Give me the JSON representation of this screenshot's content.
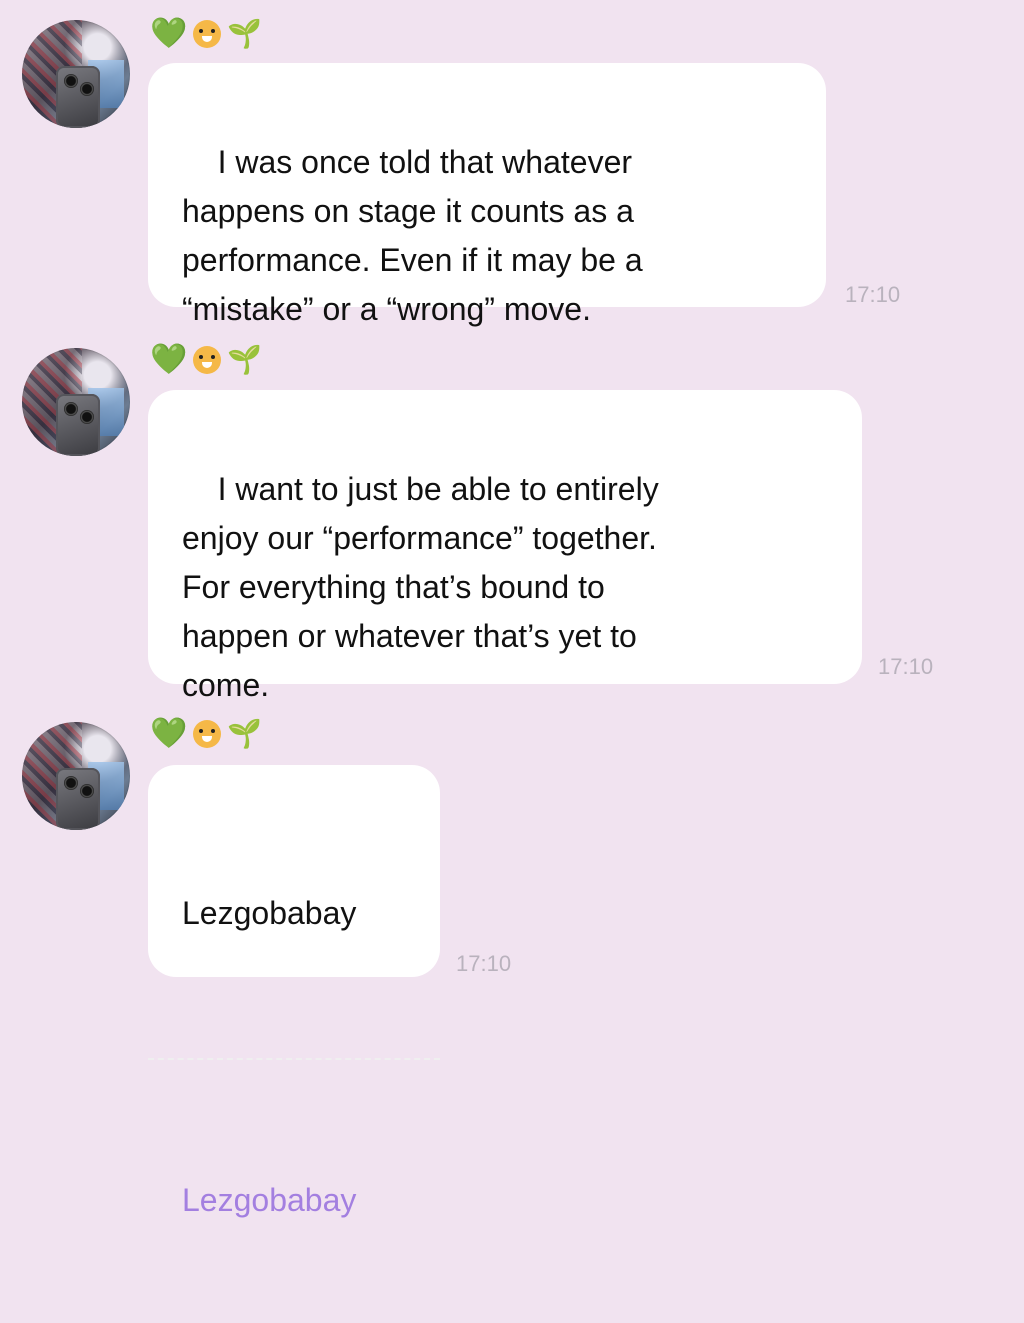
{
  "messages": [
    {
      "emoji_set": {
        "heart": "💚",
        "tiger": "tiger-face-icon",
        "sprout": "🌱"
      },
      "text": "I was once told that whatever\nhappens on stage it counts as a\nperformance. Even if it may be a\n“mistake” or a “wrong” move.",
      "time": "17:10"
    },
    {
      "emoji_set": {
        "heart": "💚",
        "tiger": "tiger-face-icon",
        "sprout": "🌱"
      },
      "text": "I want to just be able to entirely\nenjoy our “performance” together.\nFor everything that’s bound to\nhappen or whatever that’s yet to\ncome.",
      "time": "17:10"
    },
    {
      "emoji_set": {
        "heart": "💚",
        "tiger": "tiger-face-icon",
        "sprout": "🌱"
      },
      "text": "Lezgobabay",
      "translation": "Lezgobabay",
      "time": "17:10"
    }
  ],
  "colors": {
    "background": "#f1e3f0",
    "bubble": "#ffffff",
    "time": "#b9b2bd",
    "link": "#a37fe0"
  }
}
